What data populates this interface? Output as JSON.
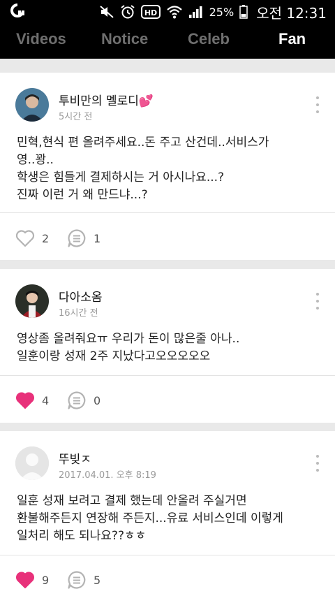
{
  "status": {
    "battery": "25%",
    "ampm": "오전",
    "time": "12:31"
  },
  "tabs": [
    "Videos",
    "Notice",
    "Celeb",
    "Fan"
  ],
  "colors": {
    "like_active": "#e8317a",
    "icon_gray": "#b3b3b3"
  },
  "posts": [
    {
      "author": "투비만의 멜로디💕",
      "time": "5시간 전",
      "lines": [
        "민혁,현식 편 올려주세요..돈 주고 산건데..서비스가",
        "영..꽝..",
        "학생은 힘들게 결제하시는 거 아시나요...?",
        "진짜 이런 거 왜 만드냐...?"
      ],
      "likes": "2",
      "comments": "1",
      "liked": false
    },
    {
      "author": "다아소옴",
      "time": "16시간 전",
      "lines": [
        "영상좀 올려줘요ㅠ 우리가 돈이 많은줄 아나..",
        "일훈이랑 성재 2주 지났다고오오오오오"
      ],
      "likes": "4",
      "comments": "0",
      "liked": true
    },
    {
      "author": "뚜빚ㅈ",
      "time": "2017.04.01. 오후 8:19",
      "lines": [
        "일훈 성재 보려고 결제 했는데 안올려 주실거면",
        "환불해주든지 연장해 주든지...유료 서비스인데 이렇게",
        "일처리 해도 되나요??ㅎㅎ"
      ],
      "likes": "9",
      "comments": "5",
      "liked": true
    }
  ]
}
